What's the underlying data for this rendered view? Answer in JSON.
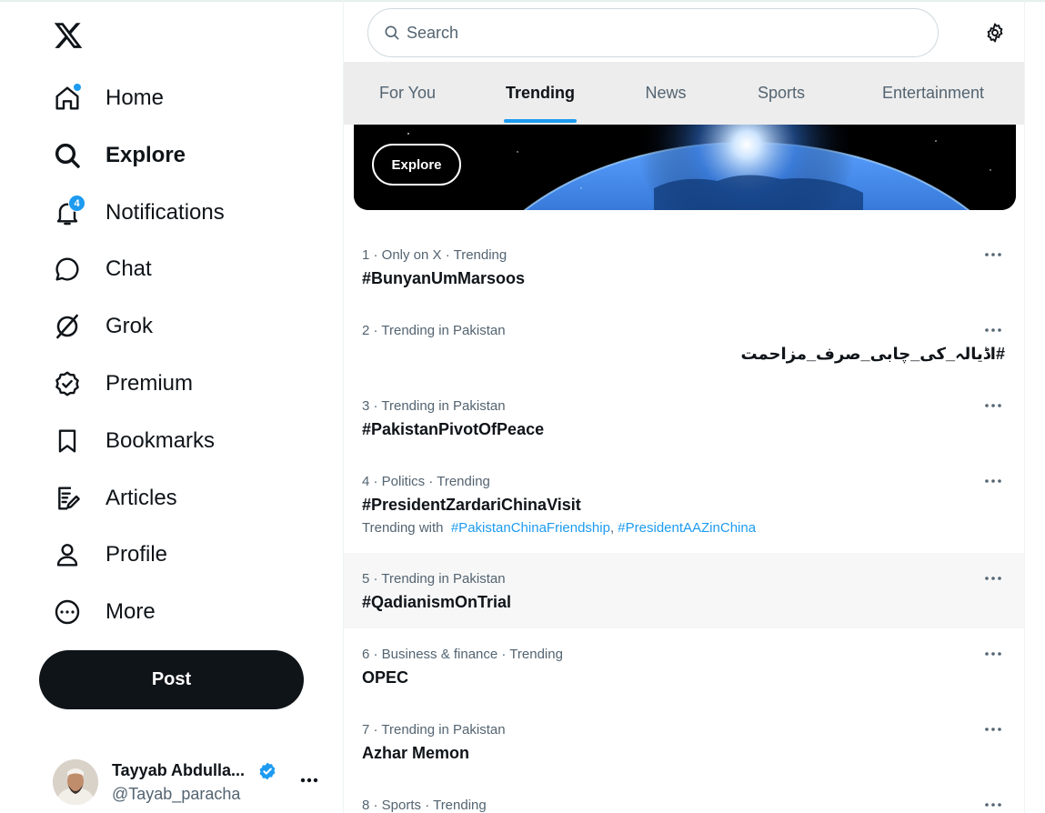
{
  "sidebar": {
    "logo": "x-logo-icon",
    "items": [
      {
        "label": "Home",
        "icon": "home-icon",
        "active": false
      },
      {
        "label": "Explore",
        "icon": "search-icon",
        "active": true
      },
      {
        "label": "Notifications",
        "icon": "bell-icon",
        "badge": "4"
      },
      {
        "label": "Chat",
        "icon": "chat-bubble-icon"
      },
      {
        "label": "Grok",
        "icon": "grok-icon"
      },
      {
        "label": "Premium",
        "icon": "premium-badge-icon"
      },
      {
        "label": "Bookmarks",
        "icon": "bookmark-icon"
      },
      {
        "label": "Articles",
        "icon": "articles-icon"
      },
      {
        "label": "Profile",
        "icon": "person-icon"
      },
      {
        "label": "More",
        "icon": "more-circle-icon"
      }
    ],
    "post_label": "Post",
    "account": {
      "name": "Tayyab Abdulla...",
      "handle": "@Tayab_paracha",
      "verified": true
    }
  },
  "search": {
    "placeholder": "Search"
  },
  "tabs": [
    {
      "label": "For You",
      "active": false
    },
    {
      "label": "Trending",
      "active": true
    },
    {
      "label": "News",
      "active": false
    },
    {
      "label": "Sports",
      "active": false
    },
    {
      "label": "Entertainment",
      "active": false
    }
  ],
  "banner": {
    "button_label": "Explore"
  },
  "trends": [
    {
      "meta": "1 · Only on X · Trending",
      "title": "#BunyanUmMarsoos"
    },
    {
      "meta": "2 · Trending in Pakistan",
      "title": "#اڈیالہ_کی_چابی_صرف_مزاحمت",
      "rtl": true
    },
    {
      "meta": "3 · Trending in Pakistan",
      "title": "#PakistanPivotOfPeace"
    },
    {
      "meta": "4 · Politics · Trending",
      "title": "#PresidentZardariChinaVisit",
      "with_label": "Trending with",
      "with_tags": [
        "#PakistanChinaFriendship",
        "#PresidentAAZinChina"
      ]
    },
    {
      "meta": "5 · Trending in Pakistan",
      "title": "#QadianismOnTrial"
    },
    {
      "meta": "6 · Business & finance · Trending",
      "title": "OPEC"
    },
    {
      "meta": "7 · Trending in Pakistan",
      "title": "Azhar Memon"
    },
    {
      "meta": "8 · Sports · Trending",
      "title": ""
    }
  ],
  "colors": {
    "accent": "#1d9bf0",
    "text_primary": "#0f1419",
    "text_secondary": "#536471"
  }
}
